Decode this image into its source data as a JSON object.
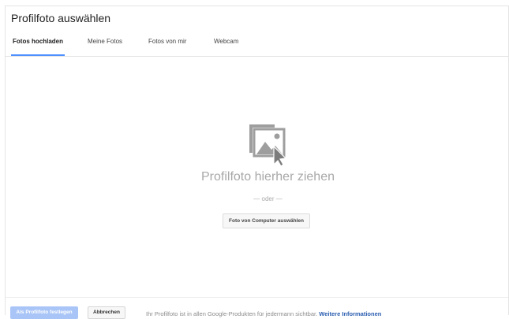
{
  "dialog": {
    "title": "Profilfoto auswählen"
  },
  "tabs": [
    {
      "label": "Fotos hochladen",
      "active": true
    },
    {
      "label": "Meine Fotos",
      "active": false
    },
    {
      "label": "Fotos von mir",
      "active": false
    },
    {
      "label": "Webcam",
      "active": false
    }
  ],
  "upload": {
    "drop_text": "Profilfoto hierher ziehen",
    "or_text": "— oder —",
    "select_button": "Foto von Computer auswählen",
    "icon": "photo-drag-icon"
  },
  "footer": {
    "primary_button": "Als Profilfoto festlegen",
    "cancel_button": "Abbrechen",
    "note": "Ihr Profilfoto ist in allen Google-Produkten für jedermann sichtbar.",
    "link": "Weitere Informationen"
  },
  "colors": {
    "accent": "#4d90fe",
    "primary_disabled": "#a9c5f7",
    "link": "#2a5db0",
    "icon_gray": "#9e9e9e"
  }
}
